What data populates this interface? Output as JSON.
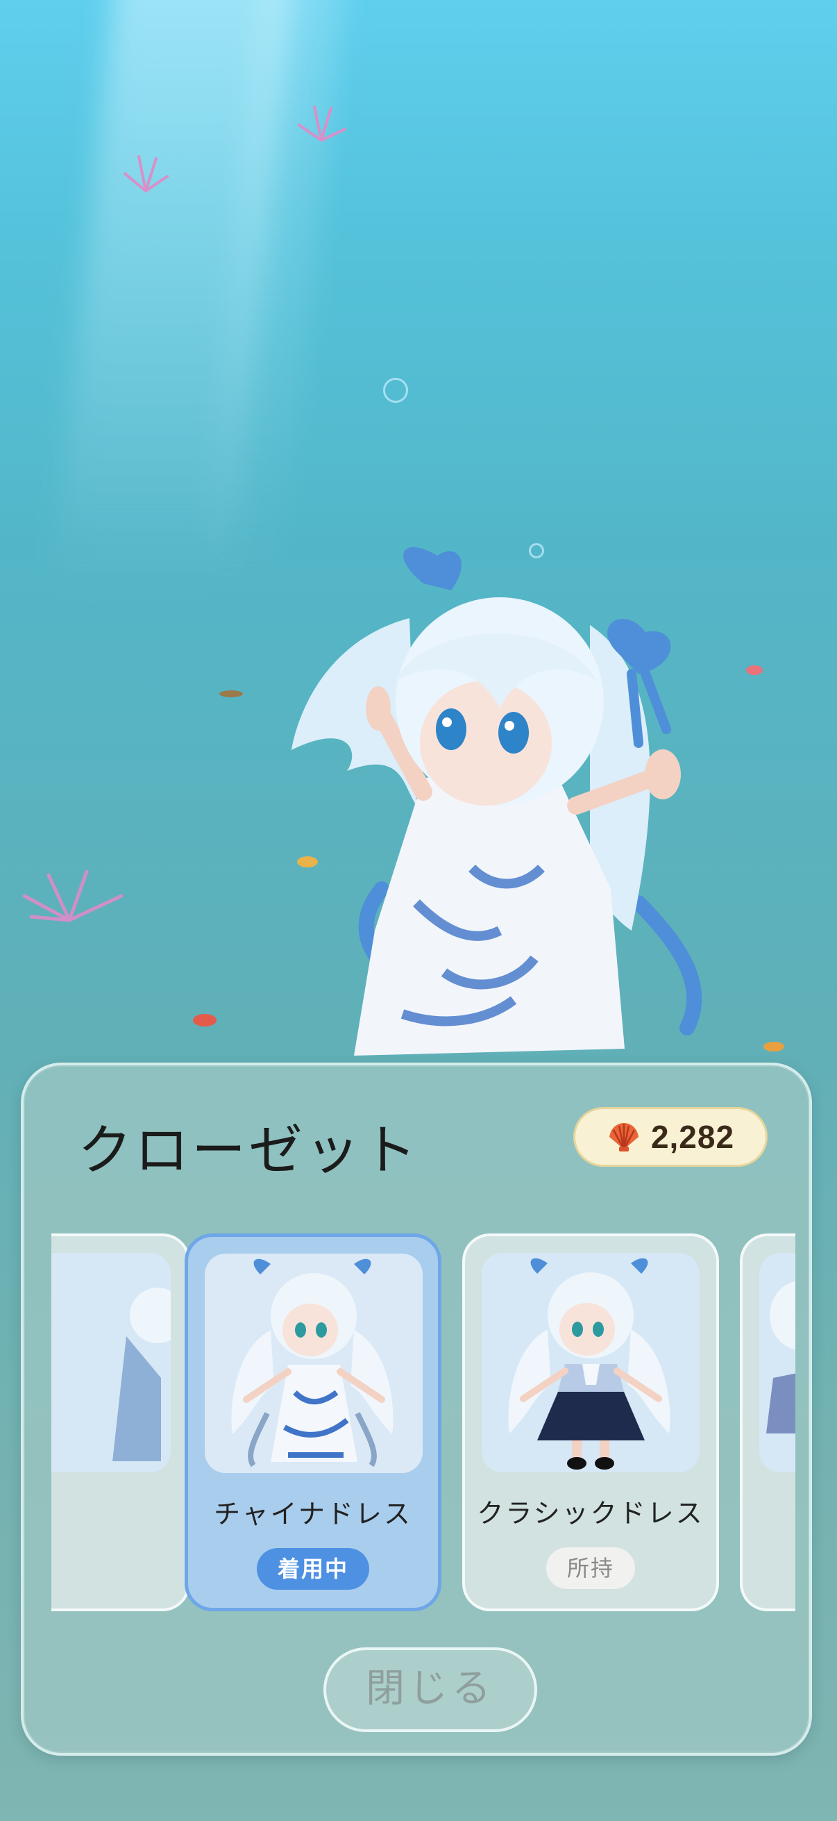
{
  "closet": {
    "title": "クローゼット",
    "currency": {
      "icon": "shell-icon",
      "value": "2,282",
      "color": "#e8663a"
    }
  },
  "outfits": [
    {
      "name": "",
      "status": "",
      "partial": "left"
    },
    {
      "name": "チャイナドレス",
      "status": "着用中",
      "selected": true,
      "dress_color": "#f4f7fb",
      "pattern_color": "#3f74c8"
    },
    {
      "name": "クラシックドレス",
      "status": "所持",
      "selected": false,
      "dress_color": "#1f2b4d",
      "pattern_color": "#c9d9f0"
    },
    {
      "name": "",
      "status": "",
      "partial": "right"
    }
  ],
  "actions": {
    "close_label": "閉じる"
  },
  "colors": {
    "accent": "#4e90e2",
    "selected_card": "#a9cdec",
    "water_top": "#5fcfee"
  }
}
